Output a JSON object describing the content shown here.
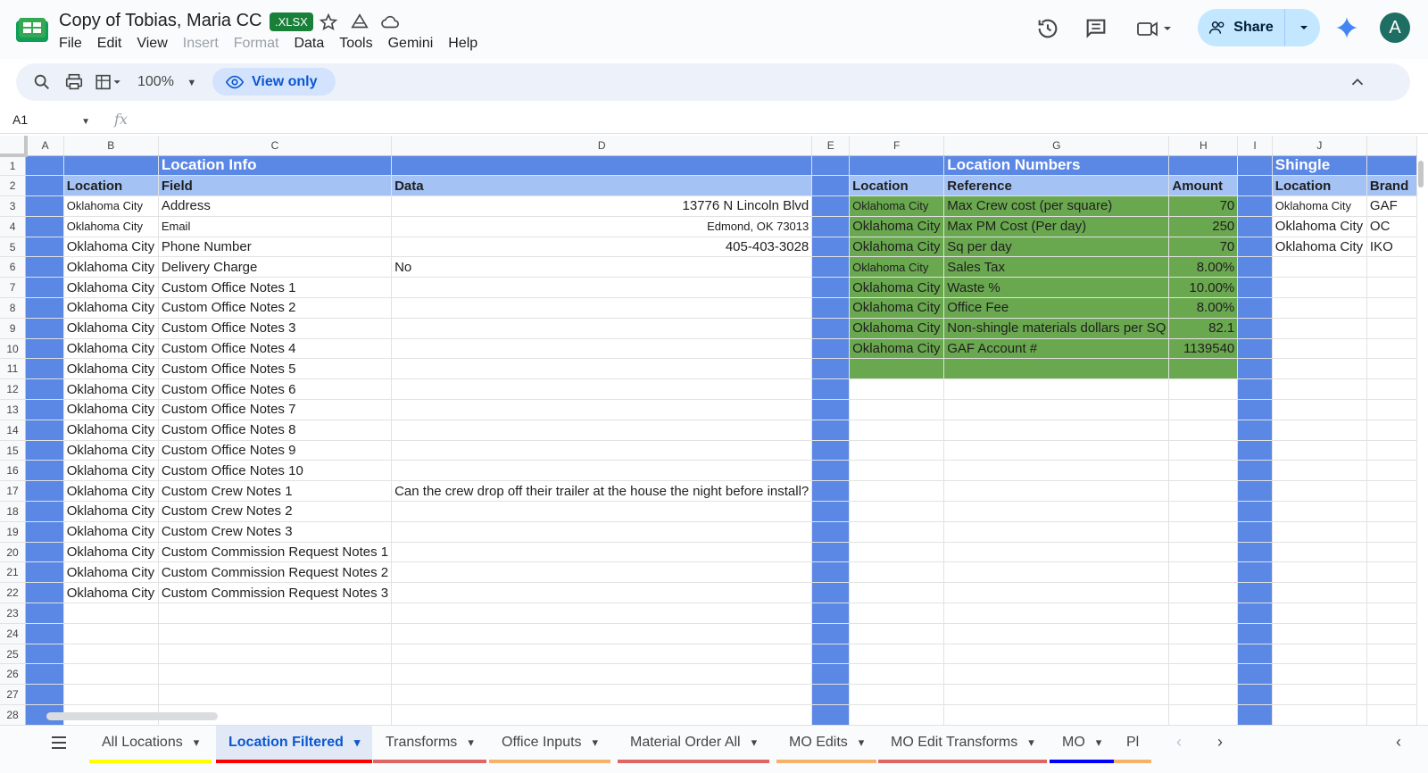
{
  "header": {
    "title": "Copy of Tobias, Maria CC",
    "badge": ".XLSX",
    "menu": [
      "File",
      "Edit",
      "View",
      "Insert",
      "Format",
      "Data",
      "Tools",
      "Gemini",
      "Help"
    ],
    "menu_disabled": [
      "Insert",
      "Format"
    ],
    "share_label": "Share",
    "avatar_letter": "A"
  },
  "toolbar": {
    "zoom": "100%",
    "view_only": "View only"
  },
  "formula_bar": {
    "name_box": "A1",
    "fx": "fx"
  },
  "columns": [
    "A",
    "B",
    "C",
    "D",
    "E",
    "F",
    "G",
    "H",
    "I",
    "J"
  ],
  "rows": [
    {
      "n": "1",
      "C": "Location Info",
      "G": "Location Numbers",
      "J": "Shingle"
    },
    {
      "n": "2",
      "B": "Location",
      "C": "Field",
      "D": "Data",
      "F": "Location",
      "G": "Reference",
      "H": "Amount",
      "J": "Location",
      "K": "Brand"
    },
    {
      "n": "3",
      "B": "Oklahoma City",
      "C": "Address",
      "D": "13776 N Lincoln Blvd",
      "F": "Oklahoma City",
      "G": "Max Crew cost (per square)",
      "H": "70",
      "J": "Oklahoma City",
      "K": "GAF"
    },
    {
      "n": "4",
      "B": "Oklahoma City",
      "C": "Email",
      "D": "Edmond, OK 73013",
      "F": "Oklahoma City",
      "G": "Max PM Cost (Per day)",
      "H": "250",
      "J": "Oklahoma City",
      "K": "OC"
    },
    {
      "n": "5",
      "B": "Oklahoma City",
      "C": "Phone Number",
      "D": "405-403-3028",
      "F": "Oklahoma City",
      "G": "Sq per day",
      "H": "70",
      "J": "Oklahoma City",
      "K": "IKO"
    },
    {
      "n": "6",
      "B": "Oklahoma City",
      "C": "Delivery Charge",
      "D": "No",
      "F": "Oklahoma City",
      "G": "Sales Tax",
      "H": "8.00%"
    },
    {
      "n": "7",
      "B": "Oklahoma City",
      "C": "Custom Office Notes 1",
      "F": "Oklahoma City",
      "G": "Waste %",
      "H": "10.00%"
    },
    {
      "n": "8",
      "B": "Oklahoma City",
      "C": "Custom Office Notes 2",
      "F": "Oklahoma City",
      "G": "Office Fee",
      "H": "8.00%"
    },
    {
      "n": "9",
      "B": "Oklahoma City",
      "C": "Custom Office Notes 3",
      "F": "Oklahoma City",
      "G": "Non-shingle materials dollars per SQ",
      "H": "82.1"
    },
    {
      "n": "10",
      "B": "Oklahoma City",
      "C": "Custom Office Notes 4",
      "F": "Oklahoma City",
      "G": "GAF Account #",
      "H": "1139540"
    },
    {
      "n": "11",
      "B": "Oklahoma City",
      "C": "Custom Office Notes 5"
    },
    {
      "n": "12",
      "B": "Oklahoma City",
      "C": "Custom Office Notes 6"
    },
    {
      "n": "13",
      "B": "Oklahoma City",
      "C": "Custom Office Notes 7"
    },
    {
      "n": "14",
      "B": "Oklahoma City",
      "C": "Custom Office Notes 8"
    },
    {
      "n": "15",
      "B": "Oklahoma City",
      "C": "Custom Office Notes 9"
    },
    {
      "n": "16",
      "B": "Oklahoma City",
      "C": "Custom Office Notes 10"
    },
    {
      "n": "17",
      "B": "Oklahoma City",
      "C": "Custom Crew Notes 1",
      "D": "Can the crew drop off their trailer at the house the night before install?"
    },
    {
      "n": "18",
      "B": "Oklahoma City",
      "C": "Custom Crew Notes 2"
    },
    {
      "n": "19",
      "B": "Oklahoma City",
      "C": "Custom Crew Notes 3"
    },
    {
      "n": "20",
      "B": "Oklahoma City",
      "C": "Custom Commission Request Notes 1"
    },
    {
      "n": "21",
      "B": "Oklahoma City",
      "C": "Custom Commission Request Notes 2"
    },
    {
      "n": "22",
      "B": "Oklahoma City",
      "C": "Custom Commission Request Notes 3"
    },
    {
      "n": "23"
    },
    {
      "n": "24"
    },
    {
      "n": "25"
    },
    {
      "n": "26"
    },
    {
      "n": "27"
    },
    {
      "n": "28"
    }
  ],
  "sheet_tabs": [
    {
      "label": "All Locations",
      "color": "#ffff00"
    },
    {
      "label": "Location Filtered",
      "color": "#ff0000",
      "active": true
    },
    {
      "label": "Transforms",
      "color": "#e06666"
    },
    {
      "label": "Office Inputs",
      "color": "#f6b26b"
    },
    {
      "label": "Material Order All",
      "color": "#e06666"
    },
    {
      "label": "MO Edits",
      "color": "#f6b26b"
    },
    {
      "label": "MO Edit Transforms",
      "color": "#e06666"
    },
    {
      "label": "MO",
      "color": "#0000ff"
    },
    {
      "label": "Pl",
      "color": "#f6b26b"
    }
  ],
  "colors": {
    "blue_fill": "#5b87e5",
    "light_blue_fill": "#a4c2f4",
    "green_fill": "#6aa84f",
    "accent": "#0b57d0"
  }
}
